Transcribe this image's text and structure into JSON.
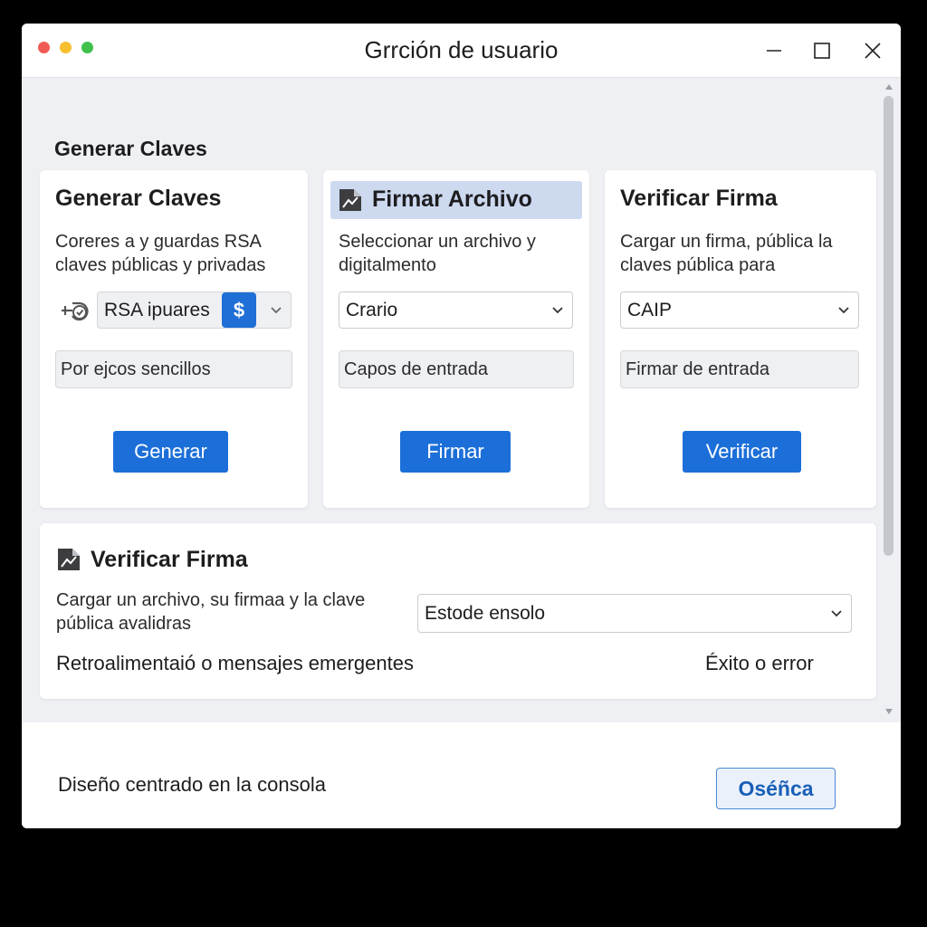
{
  "window": {
    "title": "Grrción de usuario",
    "traffic_lights": {
      "close": "#f15b55",
      "minimize": "#f6be2f",
      "maximize": "#3fc14b"
    },
    "controls": [
      "minimize-icon",
      "maximize-icon",
      "close-icon"
    ]
  },
  "section": {
    "heading": "Generar Claves"
  },
  "cards": [
    {
      "title": "Generar Claves",
      "description": "Coreres a y guardas RSA claves públicas y privadas",
      "icon": "key-clock-icon",
      "select_value": "RSA ipuares",
      "select_badge": "$",
      "input_placeholder": "Por ejcos sencillos",
      "button": "Generar"
    },
    {
      "title": "Firmar Archivo",
      "description": "Seleccionar un archivo y digitalmento",
      "icon": "file-sign-icon",
      "select_value": "Crario",
      "input_placeholder": "Capos de entrada",
      "button": "Firmar"
    },
    {
      "title": "Verificar Firma",
      "description": "Cargar un firma, pública la claves pública para",
      "select_value": "CAIP",
      "input_placeholder": "Firmar de entrada",
      "button": "Verificar"
    }
  ],
  "verify_panel": {
    "title": "Verificar Firma",
    "icon": "file-sign-icon",
    "description": "Cargar un archivo, su firmaa y la clave pública avalidras",
    "select_value": "Estode ensolo",
    "feedback": "Retroalimentaió o mensajes emergentes",
    "status": "Éxito o error"
  },
  "footer": {
    "text": "Diseño centrado en la consola",
    "button": "Oséñca"
  },
  "colors": {
    "accent": "#1c6fd8",
    "highlight": "#cdd9ef"
  }
}
